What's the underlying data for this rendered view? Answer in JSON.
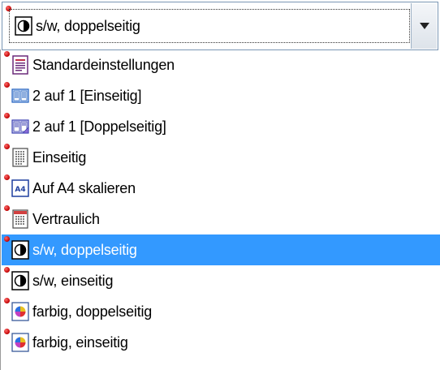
{
  "combo": {
    "selected_label": "s/w, doppelseitig",
    "selected_icon": "bw-duplex-icon"
  },
  "items": [
    {
      "label": "Standardeinstellungen",
      "icon": "default-settings-icon"
    },
    {
      "label": "2 auf 1 [Einseitig]",
      "icon": "two-up-simplex-icon"
    },
    {
      "label": "2 auf 1 [Doppelseitig]",
      "icon": "two-up-duplex-icon"
    },
    {
      "label": "Einseitig",
      "icon": "simplex-icon"
    },
    {
      "label": "Auf A4 skalieren",
      "icon": "scale-a4-icon"
    },
    {
      "label": "Vertraulich",
      "icon": "confidential-icon"
    },
    {
      "label": "s/w, doppelseitig",
      "icon": "bw-duplex-icon",
      "selected": true
    },
    {
      "label": "s/w, einseitig",
      "icon": "bw-simplex-icon"
    },
    {
      "label": "farbig, doppelseitig",
      "icon": "color-duplex-icon"
    },
    {
      "label": "farbig, einseitig",
      "icon": "color-simplex-icon"
    }
  ],
  "colors": {
    "selection": "#3399ff",
    "marker_dot": "#c00000",
    "border": "#7a96b4"
  }
}
